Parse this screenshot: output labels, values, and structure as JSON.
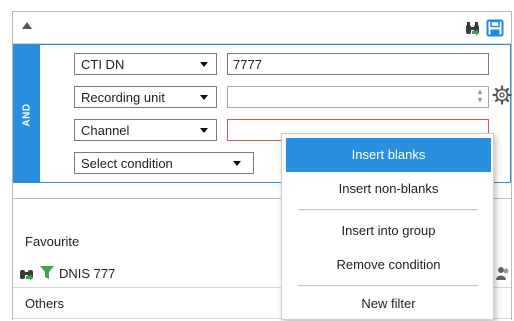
{
  "header": {
    "collapse_icon": "collapse-up-icon",
    "binoculars_icon": "binoculars-icon",
    "save_icon": "save-icon"
  },
  "filter": {
    "group_label": "AND",
    "rows": [
      {
        "field": "CTI DN",
        "value": "7777"
      },
      {
        "field": "Recording unit",
        "value": ""
      },
      {
        "field": "Channel",
        "value": ""
      },
      {
        "field": "Select condition"
      }
    ],
    "colors": {
      "accent": "#2b8fe0",
      "error_border": "#d9534f"
    }
  },
  "lists": {
    "favourite_label": "Favourite",
    "favourite_item": "DNIS 777",
    "others_label": "Others"
  },
  "context_menu": {
    "items": [
      "Insert blanks",
      "Insert non-blanks",
      "Insert into group",
      "Remove condition",
      "New filter"
    ],
    "active_index": 0
  }
}
